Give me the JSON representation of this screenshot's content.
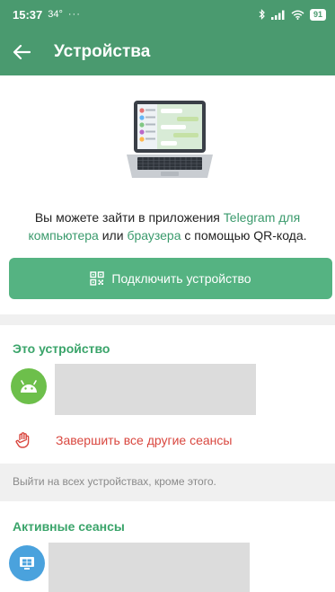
{
  "status_bar": {
    "time": "15:37",
    "temp": "34°",
    "dots": "···",
    "battery": "91"
  },
  "header": {
    "title": "Устройства",
    "back_icon": "arrow-left-icon"
  },
  "intro": {
    "part1": "Вы можете зайти в приложения ",
    "link1": "Telegram для компьютера",
    "part2": " или ",
    "link2": "браузера",
    "part3": " с помощью QR-кода."
  },
  "connect_button": {
    "label": "Подключить устройство",
    "icon": "qr-code-icon"
  },
  "this_device": {
    "title": "Это устройство",
    "icon": "android-icon"
  },
  "terminate": {
    "label": "Завершить все другие сеансы",
    "icon": "hand-icon"
  },
  "hint": "Выйти на всех устройствах, кроме этого.",
  "active_sessions": {
    "title": "Активные сеансы",
    "icon": "windows-icon"
  },
  "colors": {
    "header": "#4a9a6f",
    "accent": "#3aa46a",
    "button": "#55b382",
    "danger": "#d9473f"
  }
}
